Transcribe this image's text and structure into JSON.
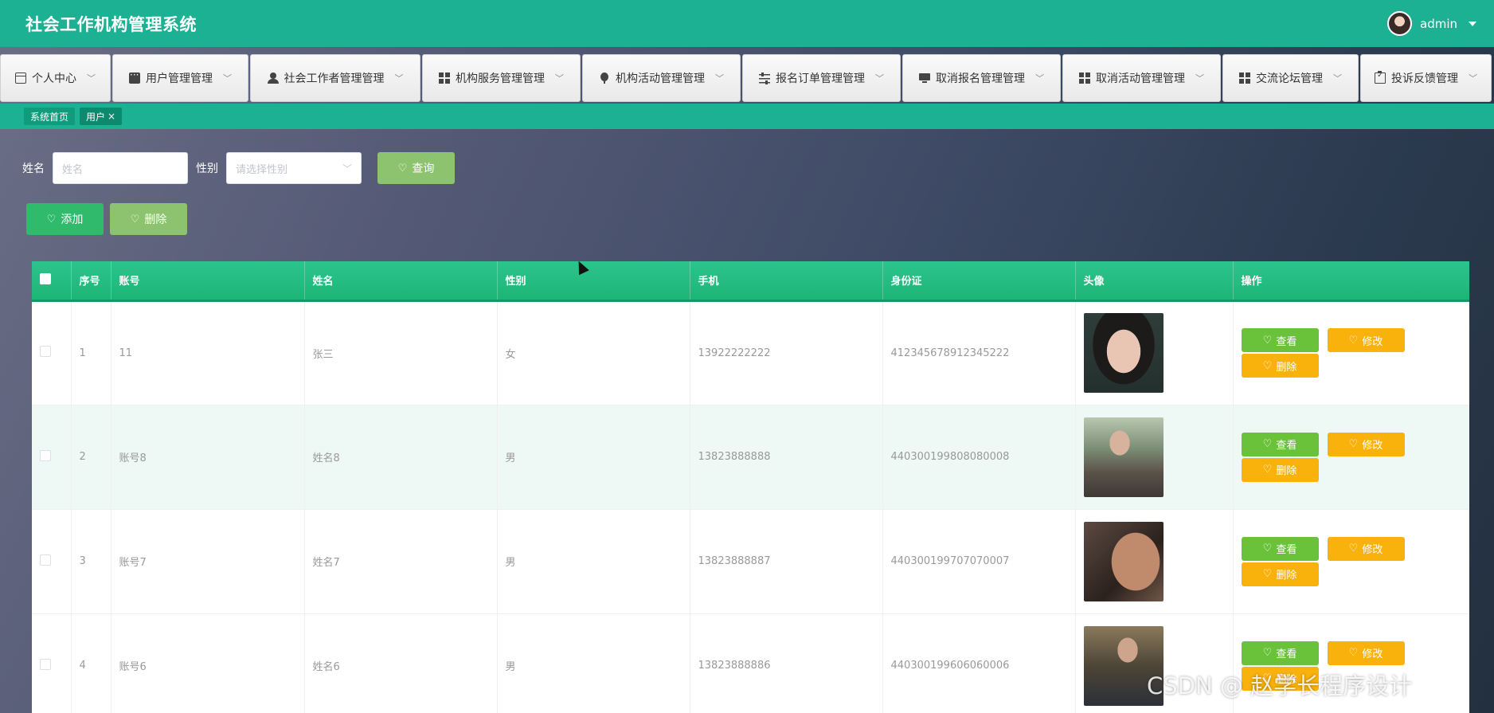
{
  "header": {
    "app_title": "社会工作机构管理系统",
    "username": "admin"
  },
  "menu": {
    "items": [
      {
        "label": "个人中心",
        "icon": "card-icon"
      },
      {
        "label": "用户管理管理",
        "icon": "chat-icon"
      },
      {
        "label": "社会工作者管理管理",
        "icon": "user-icon"
      },
      {
        "label": "机构服务管理管理",
        "icon": "grid-icon"
      },
      {
        "label": "机构活动管理管理",
        "icon": "balloon-icon"
      },
      {
        "label": "报名订单管理管理",
        "icon": "sliders-icon"
      },
      {
        "label": "取消报名管理管理",
        "icon": "monitor-icon"
      },
      {
        "label": "取消活动管理管理",
        "icon": "grid-icon"
      },
      {
        "label": "交流论坛管理",
        "icon": "grid-icon"
      },
      {
        "label": "投诉反馈管理",
        "icon": "clipboard-icon"
      }
    ]
  },
  "tags": {
    "home": "系统首页",
    "current": "用户",
    "close": "×"
  },
  "search": {
    "name_label": "姓名",
    "name_placeholder": "姓名",
    "gender_label": "性别",
    "gender_placeholder": "请选择性别",
    "query_button": "查询"
  },
  "actions": {
    "add_button": "添加",
    "delete_button": "删除"
  },
  "table": {
    "columns": [
      "序号",
      "账号",
      "姓名",
      "性别",
      "手机",
      "身份证",
      "头像",
      "操作"
    ],
    "rows": [
      {
        "index": "1",
        "account": "11",
        "name": "张三",
        "gender": "女",
        "phone": "13922222222",
        "id_card": "412345678912345222"
      },
      {
        "index": "2",
        "account": "账号8",
        "name": "姓名8",
        "gender": "男",
        "phone": "13823888888",
        "id_card": "440300199808080008"
      },
      {
        "index": "3",
        "account": "账号7",
        "name": "姓名7",
        "gender": "男",
        "phone": "13823888887",
        "id_card": "440300199707070007"
      },
      {
        "index": "4",
        "account": "账号6",
        "name": "姓名6",
        "gender": "男",
        "phone": "13823888886",
        "id_card": "440300199606060006"
      }
    ],
    "ops": {
      "view": "查看",
      "edit": "修改",
      "delete": "删除"
    }
  },
  "watermark": "CSDN @ 赵学长程序设计",
  "colors": {
    "primary": "#1bb192",
    "query": "#8dc26f",
    "add": "#2fba6c",
    "view": "#6ac23a",
    "edit": "#f9b10b"
  }
}
